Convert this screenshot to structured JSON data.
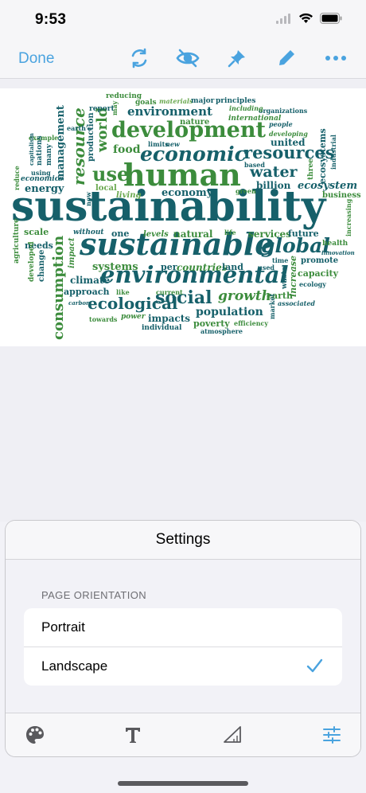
{
  "status": {
    "time": "9:53"
  },
  "toolbar": {
    "done_label": "Done"
  },
  "colors": {
    "accent": "#4aa3df",
    "word_teal": "#16606a",
    "word_green": "#3c8c3c",
    "word_lightgreen": "#6aa84f"
  },
  "word_cloud": {
    "words": [
      "sustainability",
      "sustainable",
      "environmental",
      "human",
      "development",
      "economic",
      "resources",
      "global",
      "water",
      "resource",
      "consumption",
      "management",
      "world",
      "use",
      "social",
      "ecological",
      "growth",
      "population",
      "systems",
      "energy",
      "environment",
      "economy",
      "food",
      "natural",
      "countries",
      "land",
      "climate",
      "impacts",
      "poverty",
      "services",
      "future",
      "billion",
      "united",
      "ecosystem",
      "ecosystems",
      "business",
      "scale",
      "needs",
      "per",
      "approach",
      "one",
      "living",
      "levels",
      "capacity",
      "earth",
      "increase",
      "waste",
      "goals",
      "reducing",
      "materials",
      "major",
      "principles",
      "nature",
      "international",
      "organizations",
      "developing",
      "people",
      "including",
      "based",
      "three",
      "industrial",
      "economics",
      "reduce",
      "agriculture",
      "developed",
      "change",
      "impact",
      "without",
      "like",
      "current",
      "power",
      "individual",
      "towards",
      "atmosphere",
      "efficiency",
      "market",
      "associated",
      "promote",
      "ecology",
      "time",
      "used",
      "health",
      "innovation",
      "increasing",
      "life",
      "green",
      "local",
      "now",
      "production",
      "report",
      "may",
      "earth's",
      "example",
      "capitalism",
      "nations",
      "many",
      "using",
      "limits",
      "new",
      "carbon"
    ]
  },
  "settings": {
    "title": "Settings",
    "section_label": "PAGE ORIENTATION",
    "options": [
      {
        "label": "Portrait",
        "selected": false
      },
      {
        "label": "Landscape",
        "selected": true
      }
    ]
  },
  "tabs": [
    "palette-icon",
    "text-icon",
    "shape-icon",
    "sliders-icon"
  ]
}
